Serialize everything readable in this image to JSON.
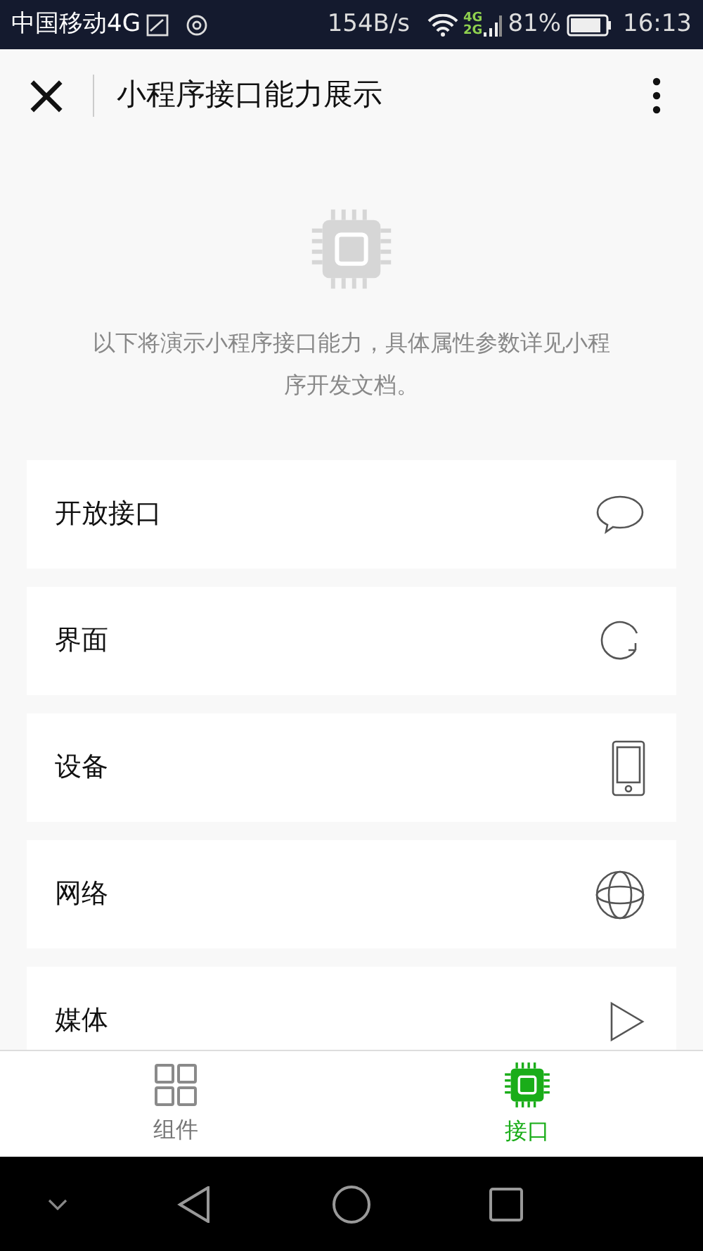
{
  "status_bar": {
    "carrier": "中国移动4G",
    "speed": "154B/s",
    "net_top": "4G",
    "net_bottom": "2G",
    "battery": "81%",
    "time": "16:13"
  },
  "header": {
    "close": "×",
    "title": "小程序接口能力展示"
  },
  "intro": {
    "text": "以下将演示小程序接口能力，具体属性参数详见小程序开发文档。"
  },
  "items": [
    {
      "label": "开放接口",
      "kind": "chat"
    },
    {
      "label": "界面",
      "kind": "refresh"
    },
    {
      "label": "设备",
      "kind": "phone"
    },
    {
      "label": "网络",
      "kind": "globe"
    },
    {
      "label": "媒体",
      "kind": "play"
    }
  ],
  "tabs": [
    {
      "label": "组件",
      "kind": "grid",
      "selected": false
    },
    {
      "label": "接口",
      "kind": "chip",
      "selected": true
    }
  ]
}
